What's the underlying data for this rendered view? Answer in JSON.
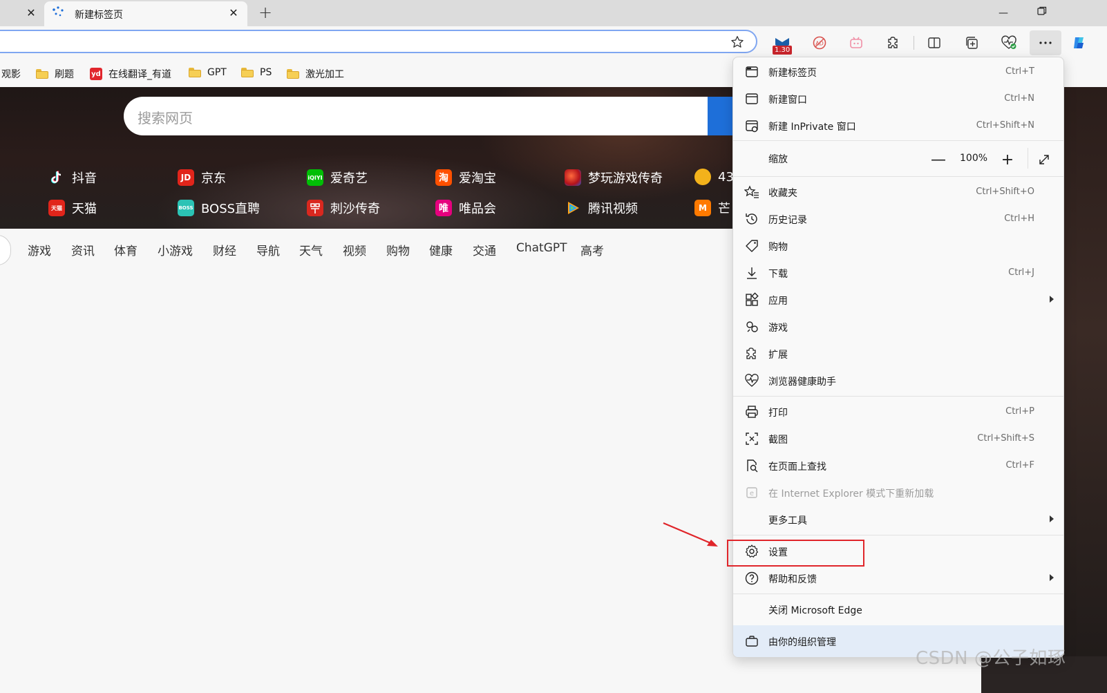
{
  "tabs": {
    "active_title": "新建标签页"
  },
  "bookmarks": [
    {
      "label": "观影",
      "type": "text"
    },
    {
      "label": "刷题",
      "type": "folder"
    },
    {
      "label": "在线翻译_有道",
      "type": "yd",
      "logo": "yd"
    },
    {
      "label": "GPT",
      "type": "folder"
    },
    {
      "label": "PS",
      "type": "folder"
    },
    {
      "label": "激光加工",
      "type": "folder"
    }
  ],
  "toolbar": {
    "extension_badge": "1.30"
  },
  "hero": {
    "search_placeholder": "搜索网页",
    "sites_row1": [
      {
        "label": "抖音",
        "logo": "",
        "color": "#111111"
      },
      {
        "label": "京东",
        "logo": "JD",
        "color": "#e1251b"
      },
      {
        "label": "爱奇艺",
        "logo": "iQIYI",
        "color": "#00be06"
      },
      {
        "label": "爱淘宝",
        "logo": "淘",
        "color": "#ff5000"
      },
      {
        "label": "梦玩游戏传奇",
        "logo": "",
        "color": "#d9281f"
      },
      {
        "label": "43",
        "logo": "",
        "color": "#f3b21b"
      }
    ],
    "sites_row2": [
      {
        "label": "天猫",
        "logo": "天猫",
        "color": "#e1251b"
      },
      {
        "label": "BOSS直聘",
        "logo": "BOSS",
        "color": "#2bc3b5"
      },
      {
        "label": "刺沙传奇",
        "logo": "",
        "color": "#d9281f"
      },
      {
        "label": "唯品会",
        "logo": "唯",
        "color": "#e6007e"
      },
      {
        "label": "腾讯视频",
        "logo": "",
        "color": "#2a9ff6"
      },
      {
        "label": "芒",
        "logo": "M",
        "color": "#ff7a00"
      }
    ]
  },
  "categories": [
    "游戏",
    "资讯",
    "体育",
    "小游戏",
    "财经",
    "导航",
    "天气",
    "视频",
    "购物",
    "健康",
    "交通",
    "ChatGPT",
    "高考"
  ],
  "menu": {
    "new_tab": {
      "label": "新建标签页",
      "shortcut": "Ctrl+T"
    },
    "new_window": {
      "label": "新建窗口",
      "shortcut": "Ctrl+N"
    },
    "new_inprivate": {
      "label": "新建 InPrivate 窗口",
      "shortcut": "Ctrl+Shift+N"
    },
    "zoom": {
      "label": "缩放",
      "value": "100%"
    },
    "favorites": {
      "label": "收藏夹",
      "shortcut": "Ctrl+Shift+O"
    },
    "history": {
      "label": "历史记录",
      "shortcut": "Ctrl+H"
    },
    "shopping": {
      "label": "购物"
    },
    "downloads": {
      "label": "下载",
      "shortcut": "Ctrl+J"
    },
    "apps": {
      "label": "应用"
    },
    "games": {
      "label": "游戏"
    },
    "extensions": {
      "label": "扩展"
    },
    "browser_essentials": {
      "label": "浏览器健康助手"
    },
    "print": {
      "label": "打印",
      "shortcut": "Ctrl+P"
    },
    "screenshot": {
      "label": "截图",
      "shortcut": "Ctrl+Shift+S"
    },
    "find": {
      "label": "在页面上查找",
      "shortcut": "Ctrl+F"
    },
    "ie_mode": {
      "label": "在 Internet Explorer 模式下重新加载"
    },
    "more_tools": {
      "label": "更多工具"
    },
    "settings": {
      "label": "设置"
    },
    "help": {
      "label": "帮助和反馈"
    },
    "close_edge": {
      "label": "关闭 Microsoft Edge"
    },
    "managed": {
      "label": "由你的组织管理"
    }
  },
  "watermark": "CSDN @公子如琢",
  "colors": {
    "accent": "#1e6fd9",
    "highlight": "#e0252a",
    "omnibox_border": "#7fa6f1"
  }
}
